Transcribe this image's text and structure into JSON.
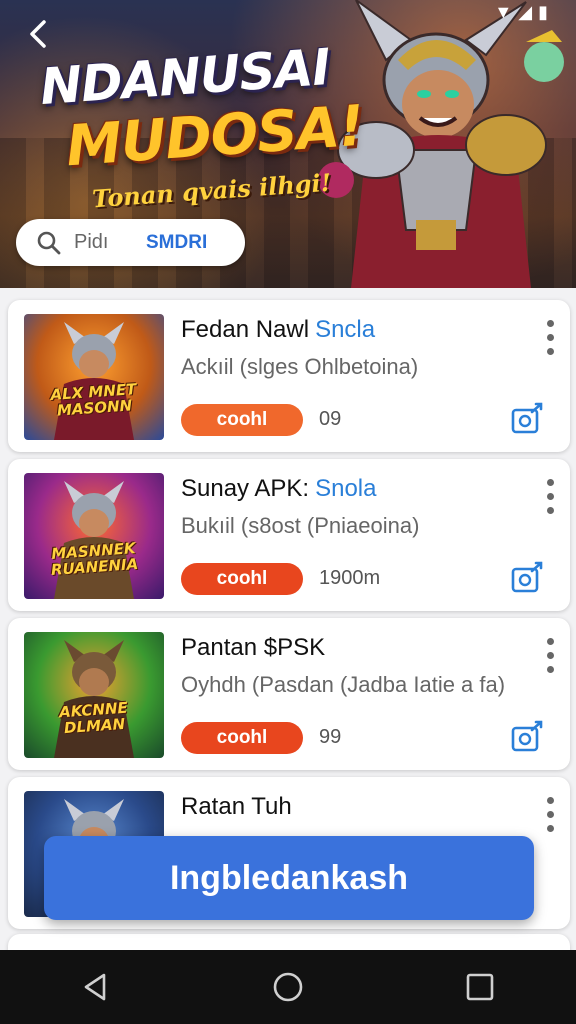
{
  "status": {
    "icons": [
      "signal-icon",
      "wifi-icon",
      "battery-icon"
    ]
  },
  "hero": {
    "back_icon": "chevron-left-icon",
    "title_line1": "NDANUSAI",
    "title_line2": "MUDOSA!",
    "subtitle": "Tonan qvais ilhgi!",
    "search_placeholder": "Pidı",
    "search_button": "SMDRI"
  },
  "items": [
    {
      "title": "Fedan Nawl",
      "title_accent": "Sncla",
      "subtitle": "Ackıil (slges Ohlbetoina)",
      "badge": "coohl",
      "badge_color": "#f0682c",
      "meta": "09",
      "thumb_label": "ALX MNET\nMASONN"
    },
    {
      "title": "Sunay APK:",
      "title_accent": "Snola",
      "subtitle": "Bukıil (s8ost (Pniaeoina)",
      "badge": "coohl",
      "badge_color": "#e8461e",
      "meta": "1900m",
      "thumb_label": "MASNNEK\nRUANENIA"
    },
    {
      "title": "Pantan $PSK",
      "title_accent": "",
      "subtitle": "Oyhdh (Pasdan (Jadba Iatie a fa)",
      "badge": "coohl",
      "badge_color": "#e8461e",
      "meta": "99",
      "thumb_label": "AKCNNE\nDLMAN"
    },
    {
      "title": "Ratan Tuh",
      "title_accent": "",
      "subtitle": "",
      "badge": "",
      "badge_color": "",
      "meta": "",
      "thumb_label": ""
    }
  ],
  "fab": {
    "label": "Ingbledankash"
  },
  "navbar": {
    "icons": [
      "back-triangle-icon",
      "home-circle-icon",
      "recents-square-icon"
    ]
  }
}
